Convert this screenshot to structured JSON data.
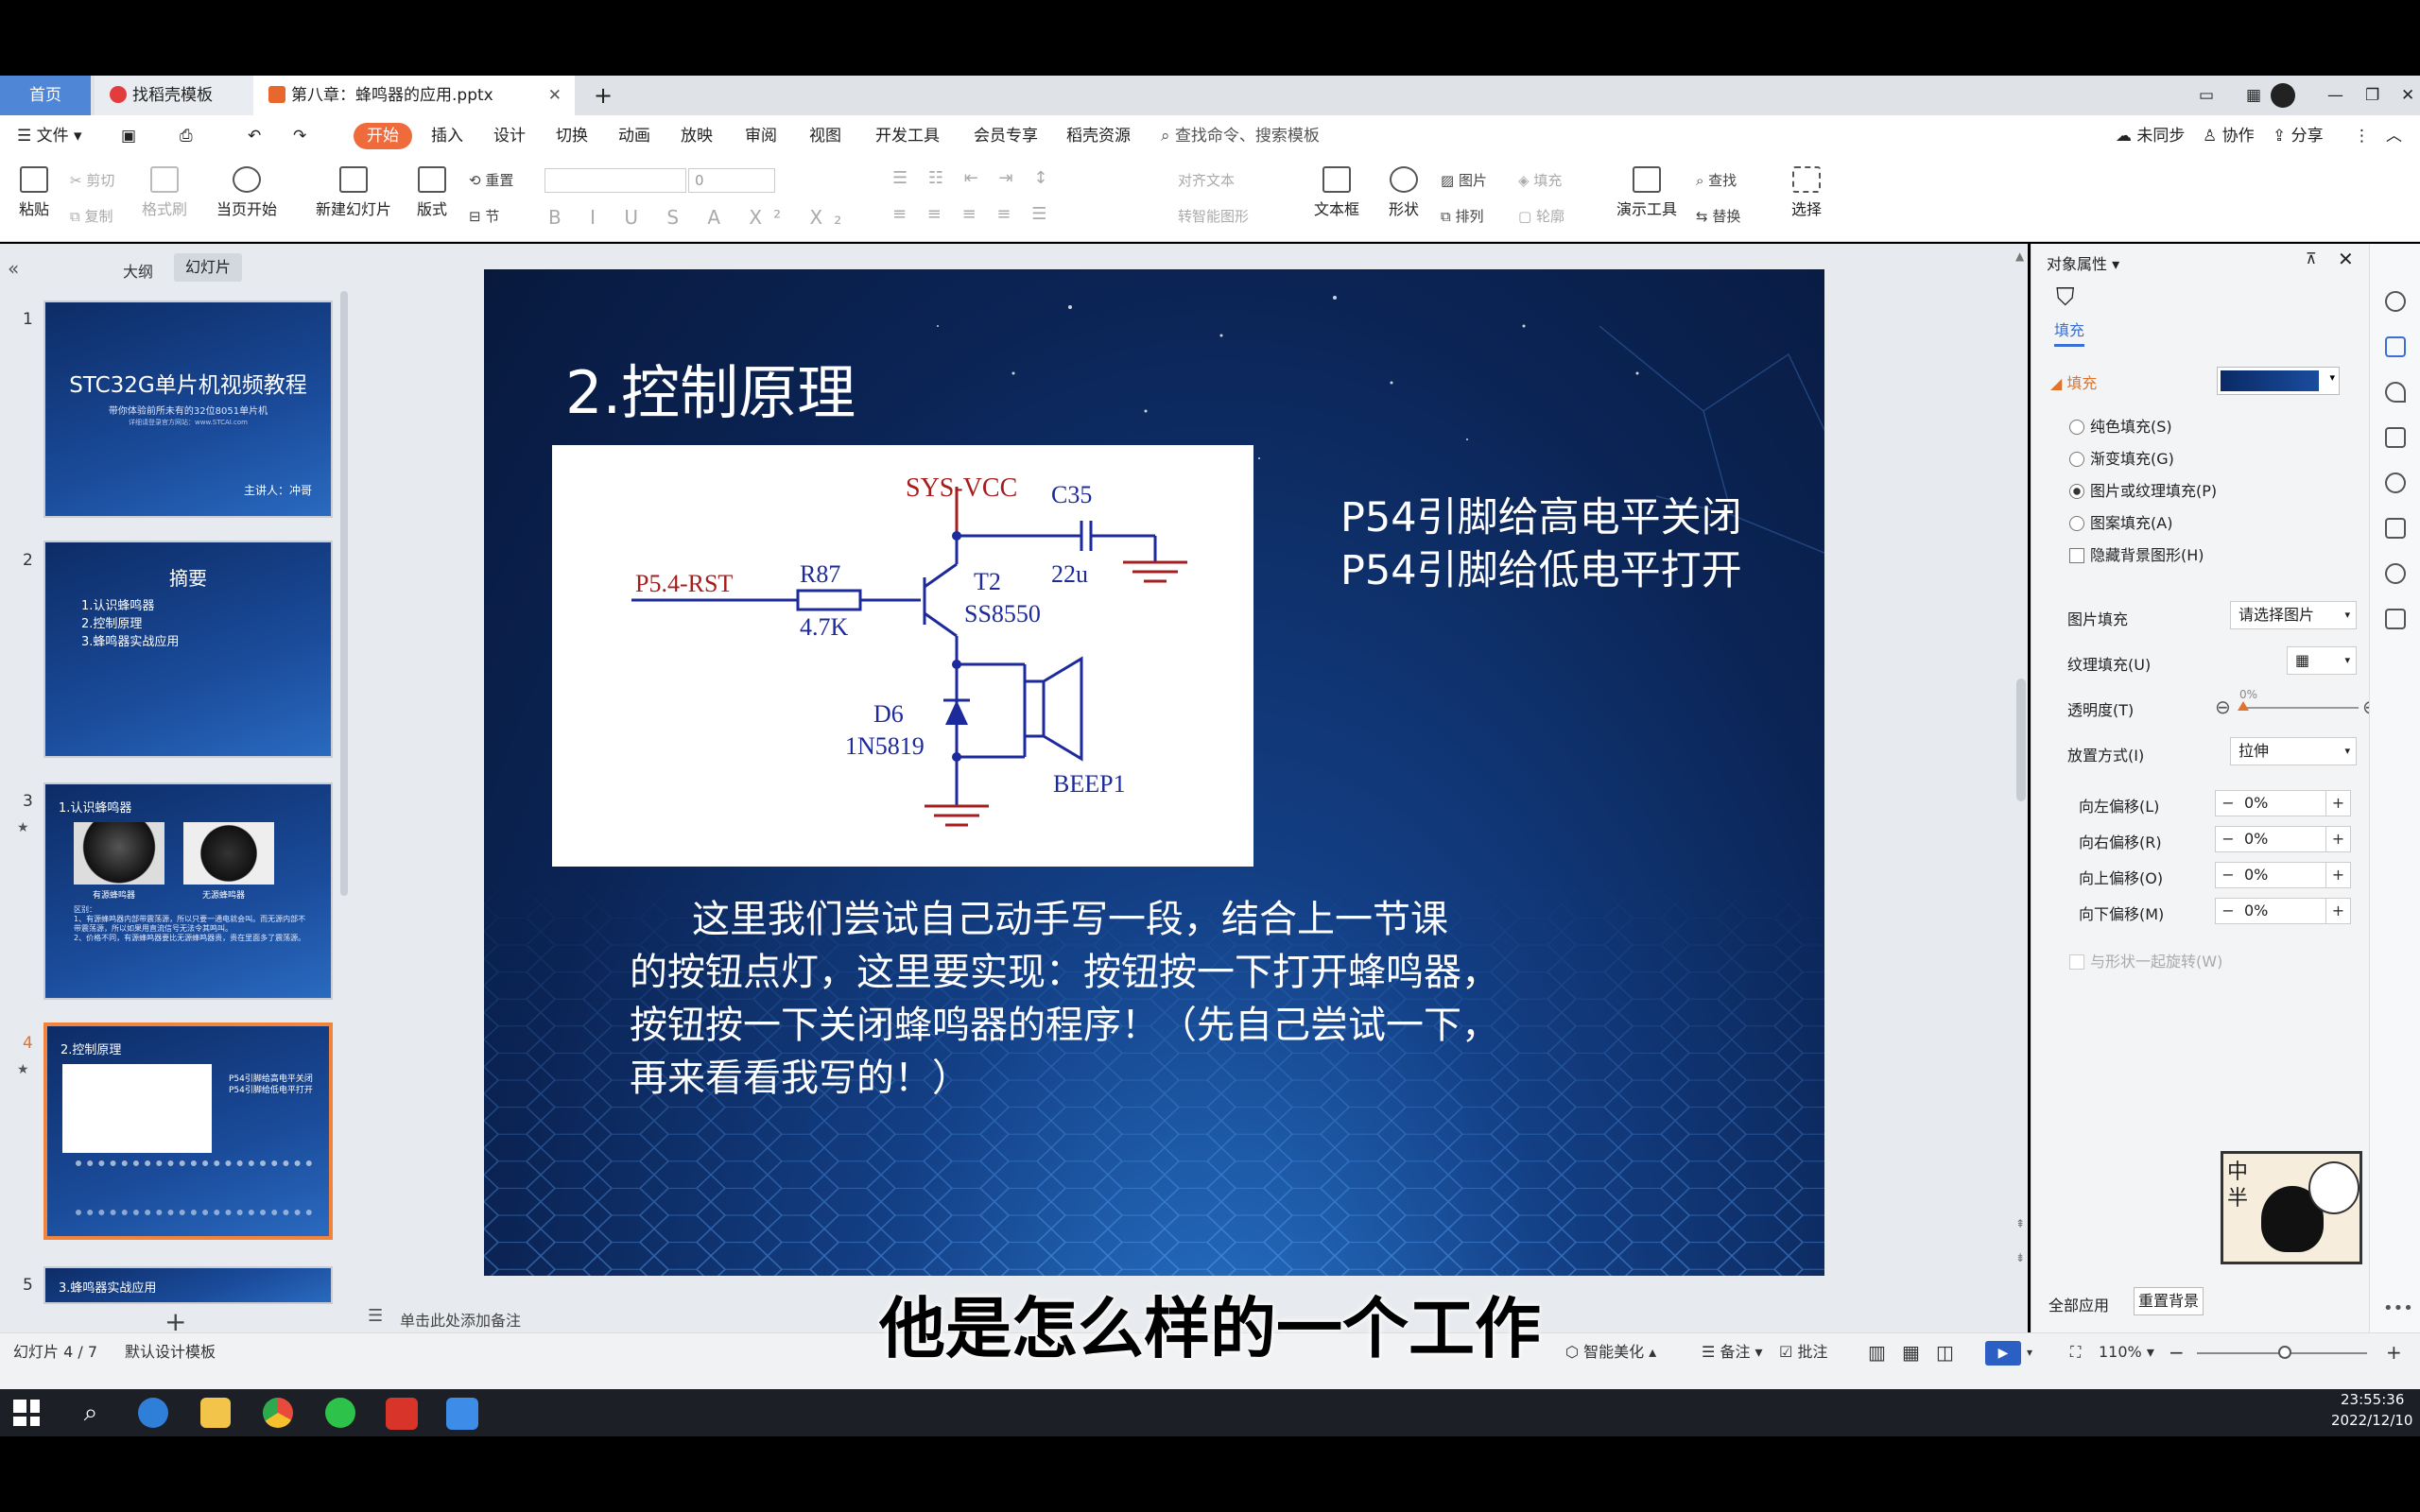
{
  "tabs": {
    "home": "首页",
    "template": "找稻壳模板",
    "document": "第八章：蜂鸣器的应用.pptx"
  },
  "menu": {
    "file": "文件",
    "items": [
      "开始",
      "插入",
      "设计",
      "切换",
      "动画",
      "放映",
      "审阅",
      "视图",
      "开发工具",
      "会员专享",
      "稻壳资源"
    ],
    "search": "查找命令、搜索模板",
    "sync": "未同步",
    "collab": "协作",
    "share": "分享"
  },
  "toolbar": {
    "paste": "粘贴",
    "cut": "剪切",
    "copy": "复制",
    "format_painter": "格式刷",
    "from_current": "当页开始",
    "new_slide": "新建幻灯片",
    "layout": "版式",
    "reset": "重置",
    "section": "节",
    "font_size": "0",
    "align_text": "对齐文本",
    "smartart": "转智能图形",
    "textbox": "文本框",
    "shape": "形状",
    "picture": "图片",
    "arrange": "排列",
    "fill": "填充",
    "outline": "轮廓",
    "present_tool": "演示工具",
    "find": "查找",
    "replace": "替换",
    "select": "选择"
  },
  "leftpanel": {
    "tab_outline": "大纲",
    "tab_slides": "幻灯片",
    "slide1": {
      "title": "STC32G单片机视频教程",
      "sub": "带你体验前所未有的32位8051单片机",
      "sub2": "详细请登录官方网站：www.STCAI.com",
      "presenter": "主讲人：冲哥"
    },
    "slide2": {
      "title": "摘要",
      "items": [
        "1.认识蜂鸣器",
        "2.控制原理",
        "3.蜂鸣器实战应用"
      ]
    },
    "slide3": {
      "title": "1.认识蜂鸣器",
      "cap1": "有源蜂鸣器",
      "cap2": "无源蜂鸣器",
      "body": "区别：\n1、有源蜂鸣器内部带震荡源，所以只要一通电就会叫。而无源内部不带震荡源，所以如果用直流信号无法令其鸣叫。\n2、价格不同，有源蜂鸣器要比无源蜂鸣器贵，贵在里面多了震荡源。"
    },
    "slide4": {
      "title": "2.控制原理"
    },
    "slide5": {
      "title": "3.蜂鸣器实战应用"
    },
    "nums": [
      "1",
      "2",
      "3",
      "4",
      "5"
    ]
  },
  "slide": {
    "title": "2.控制原理",
    "right_text1": "P54引脚给高电平关闭",
    "right_text2": "P54引脚给低电平打开",
    "body": [
      "这里我们尝试自己动手写一段，结合上一节课",
      "的按钮点灯，这里要实现：按钮按一下打开蜂鸣器，",
      "按钮按一下关闭蜂鸣器的程序！（先自己尝试一下，",
      "再来看看我写的！）"
    ],
    "schematic": {
      "vcc": "SYS-VCC",
      "c35": "C35",
      "c_val": "22u",
      "pin": "P5.4-RST",
      "r87": "R87",
      "r_val": "4.7K",
      "t2": "T2",
      "t_model": "SS8550",
      "d6": "D6",
      "d_model": "1N5819",
      "beep": "BEEP1"
    }
  },
  "notes_placeholder": "单击此处添加备注",
  "rightpanel": {
    "header": "对象属性",
    "tab": "填充",
    "section": "填充",
    "options": [
      "纯色填充(S)",
      "渐变填充(G)",
      "图片或纹理填充(P)",
      "图案填充(A)"
    ],
    "hide_bg": "隐藏背景图形(H)",
    "pic_fill_label": "图片填充",
    "pic_fill_value": "请选择图片",
    "texture_label": "纹理填充(U)",
    "transparency_label": "透明度(T)",
    "transparency_value": "0%",
    "placement_label": "放置方式(I)",
    "placement_value": "拉伸",
    "offsets": [
      {
        "label": "向左偏移(L)",
        "value": "0%"
      },
      {
        "label": "向右偏移(R)",
        "value": "0%"
      },
      {
        "label": "向上偏移(O)",
        "value": "0%"
      },
      {
        "label": "向下偏移(M)",
        "value": "0%"
      }
    ],
    "rotate_with_shape": "与形状一起旋转(W)",
    "apply_all": "全部应用",
    "reset_bg": "重置背景",
    "sticker_text": "中\n半"
  },
  "status": {
    "slide_count": "幻灯片 4 / 7",
    "template": "默认设计模板",
    "beautify": "智能美化",
    "notes": "备注",
    "comment": "批注",
    "zoom": "110%"
  },
  "taskbar": {
    "time": "23:55:36",
    "date": "2022/12/10"
  },
  "caption": "他是怎么样的一个工作",
  "colors": {
    "accent": "#f06b3b",
    "tab_home": "#4f87d6",
    "schem_red": "#a51d1d",
    "schem_blue": "#1d2a9b"
  }
}
